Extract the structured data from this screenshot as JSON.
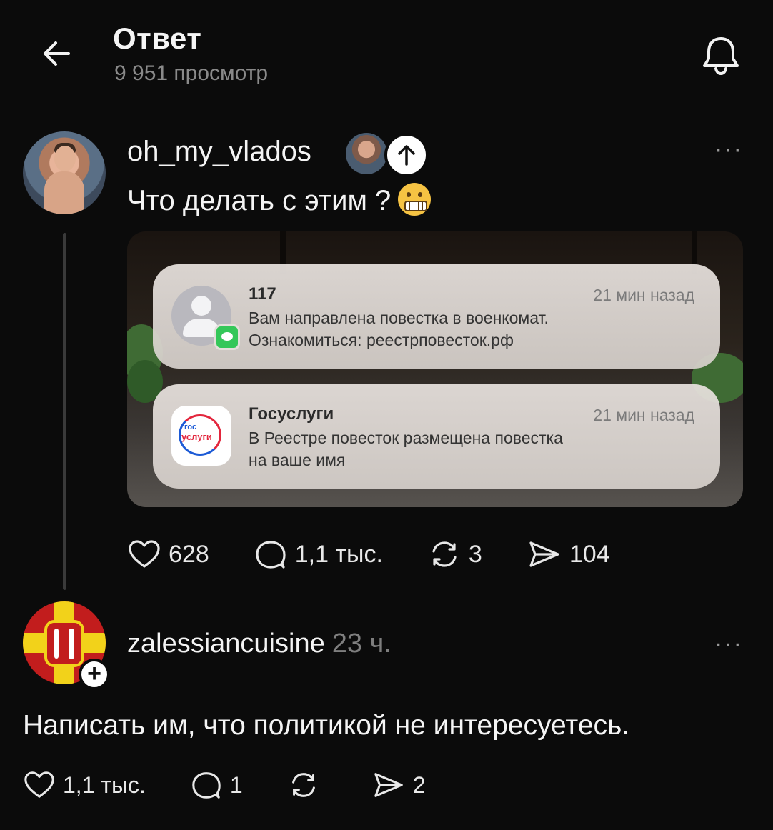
{
  "header": {
    "title": "Ответ",
    "views": "9 951 просмотр"
  },
  "post": {
    "username": "oh_my_vlados",
    "text": "Что делать с этим ?",
    "more": "···",
    "media": {
      "notifications": [
        {
          "sender": "117",
          "time": "21 мин назад",
          "body_line1": "Вам направлена повестка в военкомат.",
          "body_line2": "Ознакомиться: реестрповесток.рф",
          "icon": "contact-icon"
        },
        {
          "sender": "Госуслуги",
          "time": "21 мин назад",
          "body_line1": "В Реестре повесток размещена повестка",
          "body_line2": "на ваше имя",
          "icon": "gosuslugi-icon",
          "icon_text1": "гос",
          "icon_text2": "услуги"
        }
      ]
    },
    "actions": {
      "likes": "628",
      "comments": "1,1 тыс.",
      "reposts": "3",
      "shares": "104"
    }
  },
  "reply": {
    "username": "zalessiancuisine",
    "time": "23 ч.",
    "more": "···",
    "text": "Написать им, что политикой не интересуетесь.",
    "actions": {
      "likes": "1,1 тыс.",
      "comments": "1",
      "shares": "2"
    }
  },
  "colors": {
    "background": "#0b0b0b",
    "text": "#f4f4f4",
    "muted": "#8a8a8a"
  }
}
